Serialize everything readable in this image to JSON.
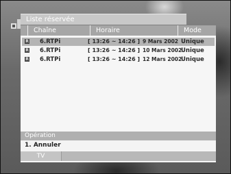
{
  "window": {
    "title": "Liste réservée"
  },
  "columns": {
    "channel": "Chaîne",
    "schedule": "Horaire",
    "mode": "Mode"
  },
  "reservations": [
    {
      "marker": "R",
      "channel": "6.RTPi",
      "time": "[ 13:26 ~ 14:26 ]",
      "date": "9 Mars 2002",
      "mode": "Unique"
    },
    {
      "marker": "R",
      "channel": "6.RTPi",
      "time": "[ 13:26 ~ 14:26 ]",
      "date": "10 Mars 2002",
      "mode": "Unique"
    },
    {
      "marker": "R",
      "channel": "6.RTPi",
      "time": "[ 13:26 ~ 14:26 ]",
      "date": "12 Mars 2002",
      "mode": "Unique"
    }
  ],
  "operations": {
    "header": "Opération",
    "items": [
      "1. Annuler"
    ]
  },
  "footer": {
    "tab_label": "TV"
  },
  "colors": {
    "header": "#a6a6a6",
    "selected_row": "#b4b4b4",
    "panel": "#f6f6f6"
  }
}
